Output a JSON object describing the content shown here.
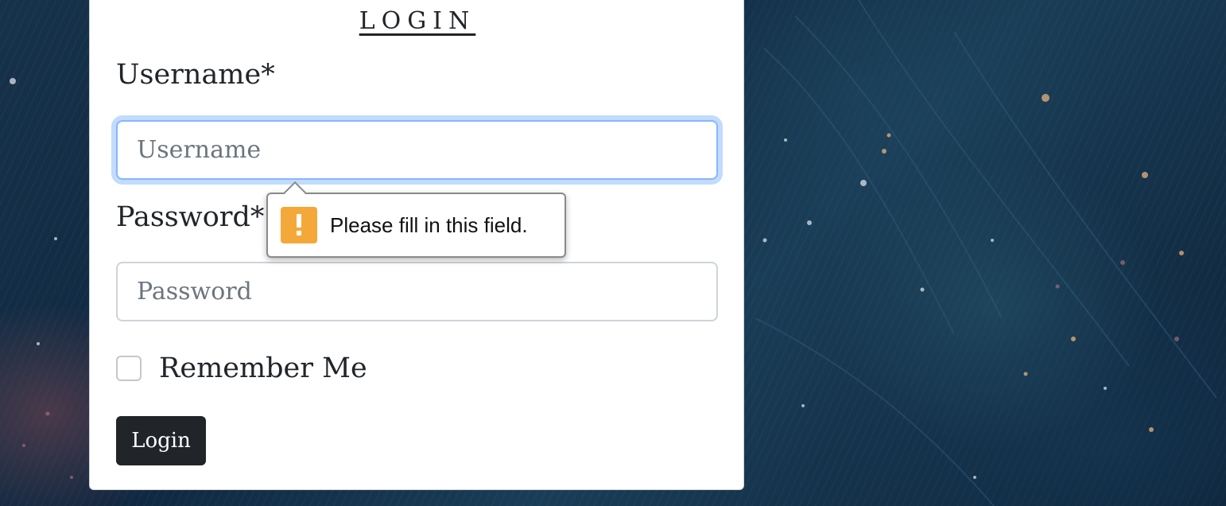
{
  "page": {
    "background_colors": [
      "#16324a",
      "#0f2740",
      "#1a3d57",
      "#0c2237"
    ]
  },
  "login_form": {
    "title": "LOGIN",
    "username": {
      "label": "Username*",
      "placeholder": "Username",
      "value": ""
    },
    "password": {
      "label": "Password*",
      "placeholder": "Password",
      "value": ""
    },
    "remember_me": {
      "label": "Remember Me",
      "checked": false
    },
    "submit_label": "Login"
  },
  "validation_tooltip": {
    "icon": "warning-icon",
    "message": "Please fill in this field.",
    "icon_color": "#f4a83a"
  },
  "colors": {
    "focus_ring": "#86b7fe",
    "button_bg": "#212529",
    "text": "#212529"
  }
}
